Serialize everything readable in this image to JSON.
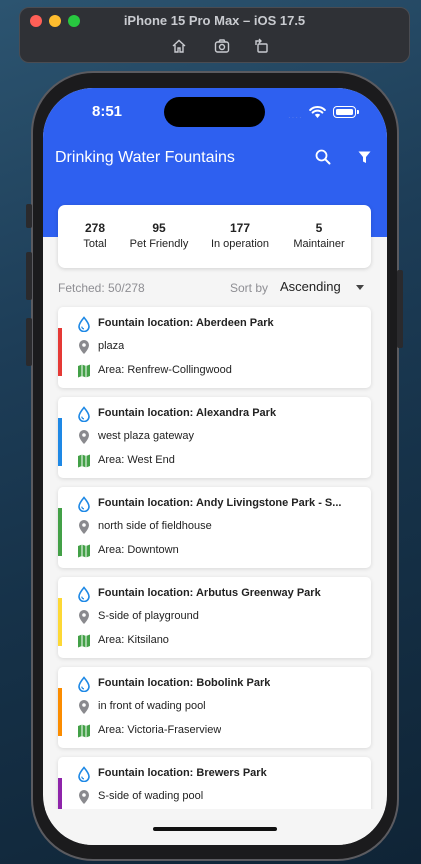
{
  "simulator": {
    "title": "iPhone 15 Pro Max – iOS 17.5",
    "tools": [
      "home-icon",
      "screenshot-icon",
      "rotate-icon"
    ]
  },
  "status_bar": {
    "time": "8:51",
    "signal_dots": "····"
  },
  "app_bar": {
    "title": "Drinking Water Fountains",
    "color": "#2e60f0"
  },
  "stats": [
    {
      "value": "278",
      "label": "Total"
    },
    {
      "value": "95",
      "label": "Pet Friendly"
    },
    {
      "value": "177",
      "label": "In operation"
    },
    {
      "value": "5",
      "label": "Maintainer"
    }
  ],
  "list_header": {
    "fetched": "Fetched: 50/278",
    "sort_label": "Sort by",
    "sort_value": "Ascending"
  },
  "fountains": [
    {
      "title": "Fountain location: Aberdeen Park",
      "location": "plaza",
      "area": "Area: Renfrew-Collingwood",
      "color": "#e53935"
    },
    {
      "title": "Fountain location: Alexandra Park",
      "location": "west plaza gateway",
      "area": "Area: West End",
      "color": "#1e88e5"
    },
    {
      "title": "Fountain location: Andy Livingstone Park - S...",
      "location": "north side of fieldhouse",
      "area": "Area: Downtown",
      "color": "#43a047"
    },
    {
      "title": "Fountain location: Arbutus Greenway Park",
      "location": "S-side of playground",
      "area": "Area: Kitsilano",
      "color": "#fdd835"
    },
    {
      "title": "Fountain location: Bobolink Park",
      "location": "in front of wading pool",
      "area": "Area: Victoria-Fraserview",
      "color": "#fb8c00"
    },
    {
      "title": "Fountain location: Brewers Park",
      "location": "S-side of wading pool",
      "area": "",
      "color": "#8e24aa"
    }
  ]
}
